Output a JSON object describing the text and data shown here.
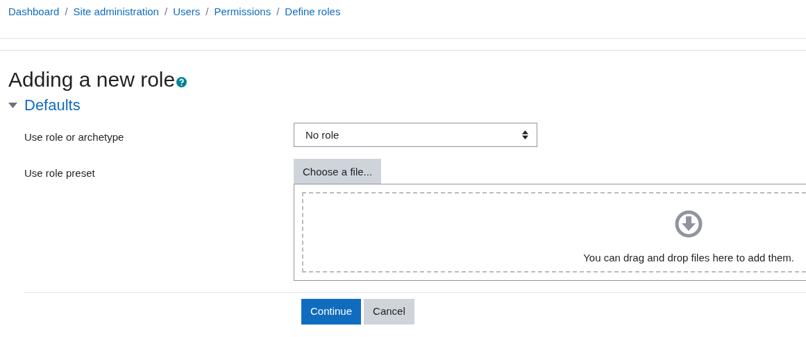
{
  "breadcrumb": [
    {
      "label": "Dashboard"
    },
    {
      "separator": "/",
      "label": "Site administration"
    },
    {
      "separator": "/",
      "label": "Users"
    },
    {
      "separator": "/",
      "label": "Permissions"
    },
    {
      "separator": "/",
      "label": "Define roles"
    }
  ],
  "heading": "Adding a new role",
  "section": {
    "title": "Defaults",
    "expanded": true,
    "fields": [
      {
        "kind": "select",
        "label": "Use role or archetype",
        "value": "No role"
      },
      {
        "kind": "filepicker",
        "label": "Use role preset",
        "button": "Choose a file...",
        "drop_text": "You can drag and drop files here to add them."
      }
    ]
  },
  "buttons": [
    {
      "label": "Continue",
      "kind": "primary"
    },
    {
      "label": "Cancel",
      "kind": "secondary"
    }
  ]
}
